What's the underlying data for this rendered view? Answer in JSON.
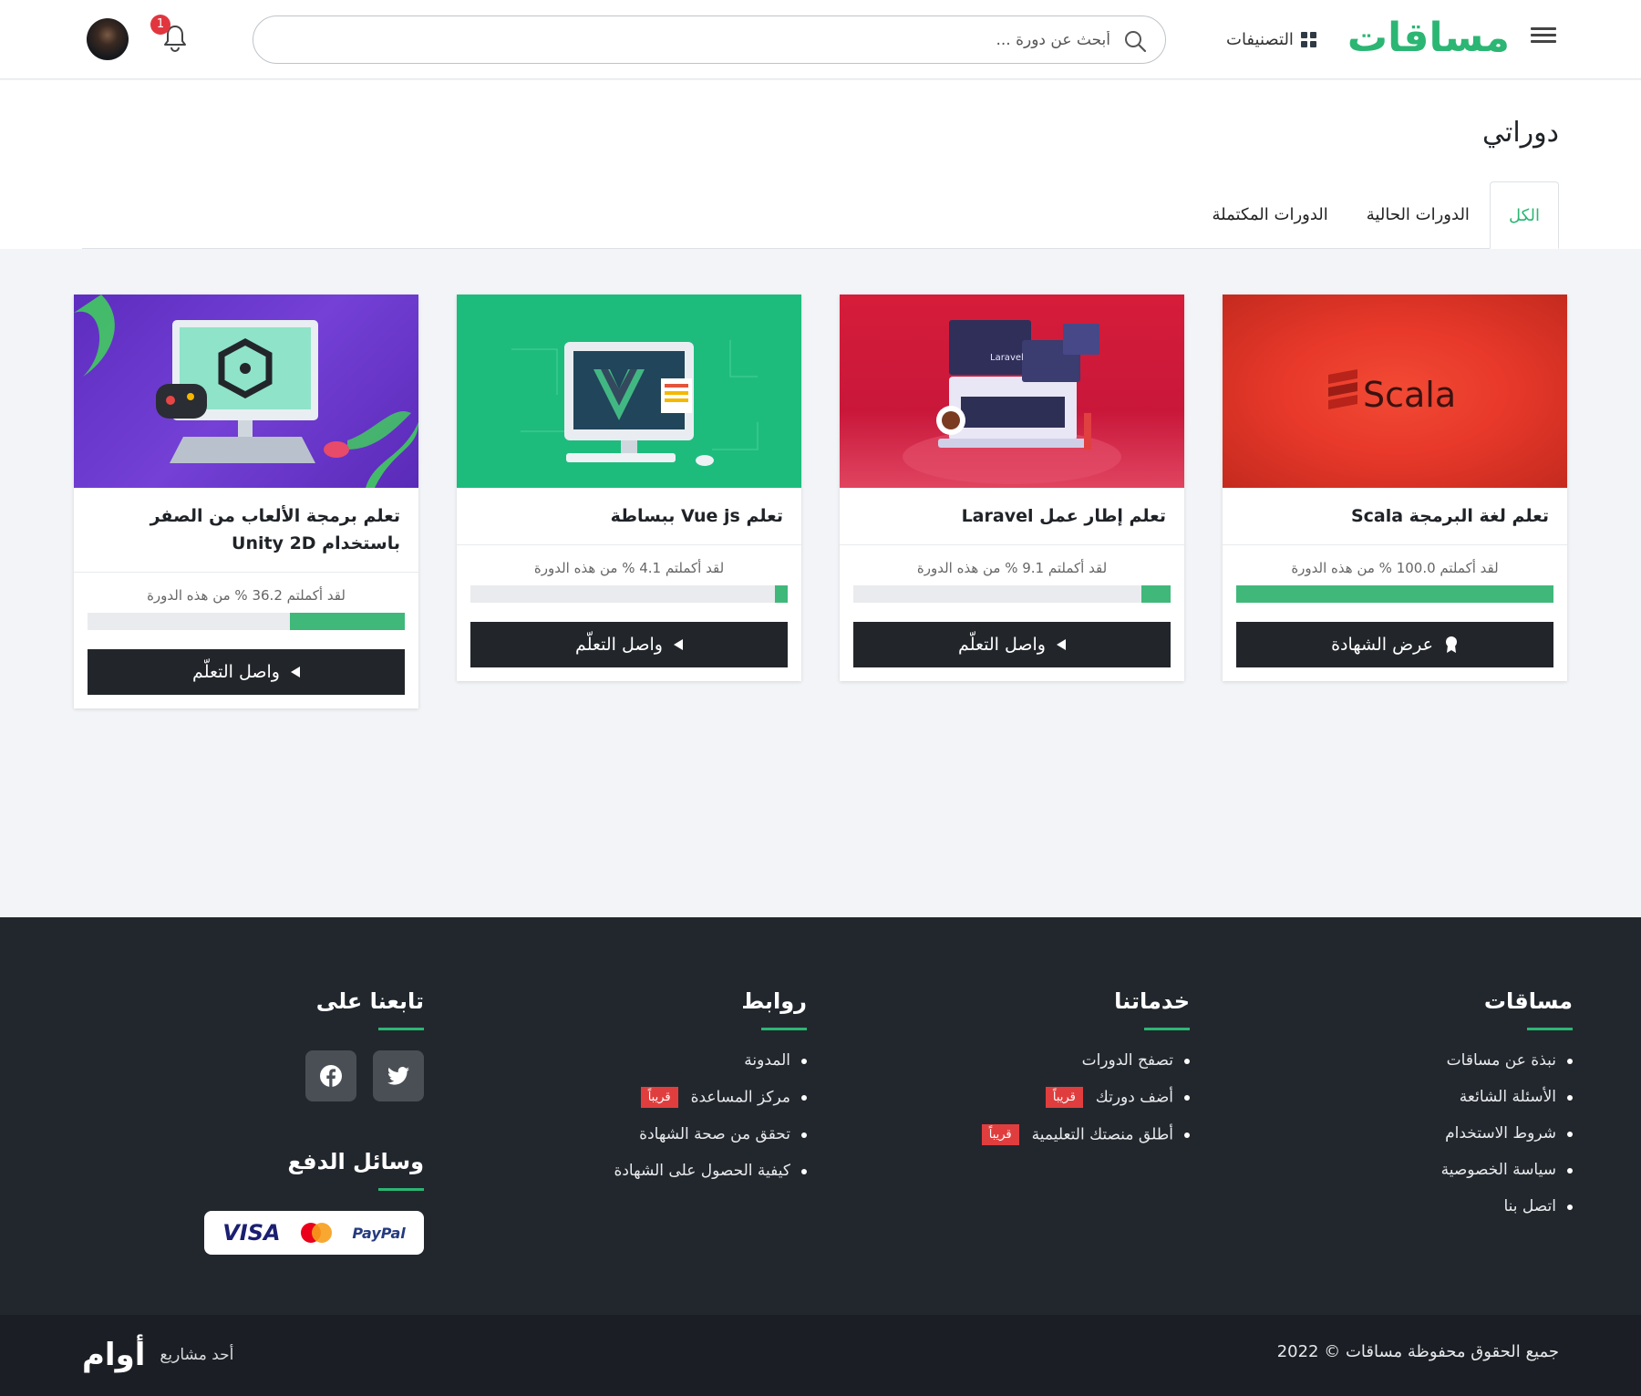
{
  "header": {
    "logo_text": "مساقات",
    "categories_label": "التصنيفات",
    "search_placeholder": "أبحث عن دورة ...",
    "notification_count": "1"
  },
  "page": {
    "title": "دوراتي",
    "tabs": [
      {
        "label": "الكل",
        "active": true
      },
      {
        "label": "الدورات الحالية",
        "active": false
      },
      {
        "label": "الدورات المكتملة",
        "active": false
      }
    ]
  },
  "courses": [
    {
      "title": "تعلم لغة البرمجة Scala",
      "progress_text": "لقد أكملتم 100.0 % من هذه الدورة",
      "progress": 100.0,
      "button": "عرض الشهادة",
      "thumb_text": "Scala",
      "thumb_color": "#e8392b"
    },
    {
      "title": "تعلم إطار عمل Laravel",
      "progress_text": "لقد أكملتم 9.1 % من هذه الدورة",
      "progress": 9.1,
      "button": "واصل التعلّم",
      "thumb_text": "Laravel",
      "thumb_color": "#d21f3c"
    },
    {
      "title": "تعلم Vue js ببساطة",
      "progress_text": "لقد أكملتم 4.1 % من هذه الدورة",
      "progress": 4.1,
      "button": "واصل التعلّم",
      "thumb_color": "#1dbc7d"
    },
    {
      "title": "تعلم برمجة الألعاب من الصفر باستخدام Unity 2D",
      "progress_text": "لقد أكملتم 36.2 % من هذه الدورة",
      "progress": 36.2,
      "button": "واصل التعلّم",
      "thumb_color": "#6a33c9"
    }
  ],
  "footer": {
    "col1": {
      "title": "مساقات",
      "items": [
        "نبذة عن مساقات",
        "الأسئلة الشائعة",
        "شروط الاستخدام",
        "سياسة الخصوصية",
        "اتصل بنا"
      ]
    },
    "col2": {
      "title": "خدماتنا",
      "items": [
        "تصفح الدورات",
        "أضف دورتك",
        "أطلق منصتك التعليمية"
      ]
    },
    "col3": {
      "title": "روابط",
      "items": [
        "المدونة",
        "مركز المساعدة",
        "تحقق من صحة الشهادة",
        "كيفية الحصول على الشهادة"
      ]
    },
    "soon_label": "قريباً",
    "follow_title": "تابعنا على",
    "payment_title": "وسائل الدفع",
    "payment_methods": [
      "VISA",
      "MasterCard",
      "PayPal"
    ],
    "copyright": "جميع الحقوق محفوظة مساقات © 2022",
    "brand_prefix": "أحد مشاريع",
    "brand_name": "أوام"
  },
  "colors": {
    "accent": "#2bb673",
    "footer_bg": "#22272e",
    "button_bg": "#22262b",
    "soon_bg": "#e03e3e"
  }
}
